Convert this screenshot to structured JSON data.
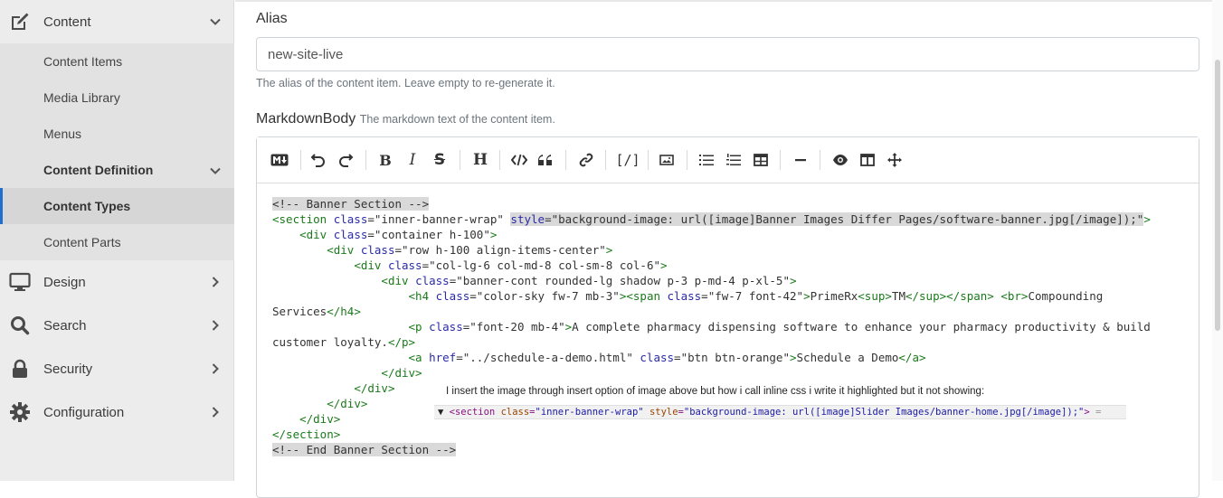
{
  "sidebar": {
    "content": {
      "label": "Content"
    },
    "content_items": {
      "label": "Content Items"
    },
    "media_library": {
      "label": "Media Library"
    },
    "menus": {
      "label": "Menus"
    },
    "content_definition": {
      "label": "Content Definition"
    },
    "content_types": {
      "label": "Content Types"
    },
    "content_parts": {
      "label": "Content Parts"
    },
    "design": {
      "label": "Design"
    },
    "search": {
      "label": "Search"
    },
    "security": {
      "label": "Security"
    },
    "configuration": {
      "label": "Configuration"
    }
  },
  "form": {
    "alias": {
      "label": "Alias",
      "value": "new-site-live",
      "help": "The alias of the content item. Leave empty to re-generate it."
    },
    "markdown": {
      "label": "MarkdownBody",
      "help": "The markdown text of the content item."
    }
  },
  "toolbar": {
    "icons": [
      "markdown-icon",
      "undo-icon",
      "redo-icon",
      "bold-icon",
      "italic-icon",
      "strikethrough-icon",
      "heading-icon",
      "code-icon",
      "quote-icon",
      "link-icon",
      "shortcode-icon",
      "image-icon",
      "unordered-list-icon",
      "ordered-list-icon",
      "table-icon",
      "horizontal-rule-icon",
      "preview-icon",
      "side-by-side-icon",
      "fullscreen-icon"
    ],
    "shortcode_glyph": "[/]"
  },
  "code": {
    "lines": [
      [
        {
          "c": "cm",
          "t": "<!-- Banner Section -->",
          "hl": true
        }
      ],
      [
        {
          "c": "tg",
          "t": "<section "
        },
        {
          "c": "at",
          "t": "class"
        },
        {
          "c": "st",
          "t": "=\"inner-banner-wrap\" "
        },
        {
          "c": "at",
          "t": "style",
          "hl": true
        },
        {
          "c": "st",
          "t": "=\"background-image: url([image]Banner Images Differ Pages/software-banner.jpg[/image]);\"",
          "hl": true
        },
        {
          "c": "tg",
          "t": ">"
        }
      ],
      [
        {
          "c": "st",
          "t": "    "
        },
        {
          "c": "tg",
          "t": "<div "
        },
        {
          "c": "at",
          "t": "class"
        },
        {
          "c": "st",
          "t": "=\"container h-100\""
        },
        {
          "c": "tg",
          "t": ">"
        }
      ],
      [
        {
          "c": "st",
          "t": "        "
        },
        {
          "c": "tg",
          "t": "<div "
        },
        {
          "c": "at",
          "t": "class"
        },
        {
          "c": "st",
          "t": "=\"row h-100 align-items-center\""
        },
        {
          "c": "tg",
          "t": ">"
        }
      ],
      [
        {
          "c": "st",
          "t": "            "
        },
        {
          "c": "tg",
          "t": "<div "
        },
        {
          "c": "at",
          "t": "class"
        },
        {
          "c": "st",
          "t": "=\"col-lg-6 col-md-8 col-sm-8 col-6\""
        },
        {
          "c": "tg",
          "t": ">"
        }
      ],
      [
        {
          "c": "st",
          "t": "                "
        },
        {
          "c": "tg",
          "t": "<div "
        },
        {
          "c": "at",
          "t": "class"
        },
        {
          "c": "st",
          "t": "=\"banner-cont rounded-lg shadow p-3 p-md-4 p-xl-5\""
        },
        {
          "c": "tg",
          "t": ">"
        }
      ],
      [
        {
          "c": "st",
          "t": "                    "
        },
        {
          "c": "tg",
          "t": "<h4 "
        },
        {
          "c": "at",
          "t": "class"
        },
        {
          "c": "st",
          "t": "=\"color-sky fw-7 mb-3\""
        },
        {
          "c": "tg",
          "t": "><span "
        },
        {
          "c": "at",
          "t": "class"
        },
        {
          "c": "st",
          "t": "=\"fw-7 font-42\""
        },
        {
          "c": "tg",
          "t": ">"
        },
        {
          "c": "st",
          "t": "PrimeRx"
        },
        {
          "c": "tg",
          "t": "<sup>"
        },
        {
          "c": "st",
          "t": "TM"
        },
        {
          "c": "tg",
          "t": "</sup></span>"
        },
        {
          "c": "st",
          "t": " "
        },
        {
          "c": "tg",
          "t": "<br>"
        },
        {
          "c": "st",
          "t": "Compounding"
        }
      ],
      [
        {
          "c": "st",
          "t": "Services"
        },
        {
          "c": "tg",
          "t": "</h4>"
        }
      ],
      [
        {
          "c": "st",
          "t": "                    "
        },
        {
          "c": "tg",
          "t": "<p "
        },
        {
          "c": "at",
          "t": "class"
        },
        {
          "c": "st",
          "t": "=\"font-20 mb-4\""
        },
        {
          "c": "tg",
          "t": ">"
        },
        {
          "c": "st",
          "t": "A complete pharmacy dispensing software to enhance your pharmacy productivity & build"
        }
      ],
      [
        {
          "c": "st",
          "t": "customer loyalty."
        },
        {
          "c": "tg",
          "t": "</p>"
        }
      ],
      [
        {
          "c": "st",
          "t": "                    "
        },
        {
          "c": "tg",
          "t": "<a "
        },
        {
          "c": "at",
          "t": "href"
        },
        {
          "c": "st",
          "t": "=\"../schedule-a-demo.html\" "
        },
        {
          "c": "at",
          "t": "class"
        },
        {
          "c": "st",
          "t": "=\"btn btn-orange\""
        },
        {
          "c": "tg",
          "t": ">"
        },
        {
          "c": "st",
          "t": "Schedule a Demo"
        },
        {
          "c": "tg",
          "t": "</a>"
        }
      ],
      [
        {
          "c": "st",
          "t": "                "
        },
        {
          "c": "tg",
          "t": "</div>"
        }
      ],
      [
        {
          "c": "st",
          "t": "            "
        },
        {
          "c": "tg",
          "t": "</div>"
        }
      ],
      [
        {
          "c": "st",
          "t": "        "
        },
        {
          "c": "tg",
          "t": "</div>"
        }
      ],
      [
        {
          "c": "st",
          "t": "    "
        },
        {
          "c": "tg",
          "t": "</div>"
        }
      ],
      [
        {
          "c": "tg",
          "t": "</section>"
        }
      ],
      [
        {
          "c": "cm",
          "t": "<!-- End Banner Section -->",
          "hl": true
        }
      ]
    ]
  },
  "note": {
    "text": "I insert the image through insert option of image above but how i call inline css i write it highlighted but it not showing:"
  },
  "devtools": {
    "arrow": "▼",
    "open": "<section",
    "attr1": "class",
    "val1": "\"inner-banner-wrap\"",
    "attr2": "style",
    "val2": "\"background-image: url([image]Slider Images/banner-home.jpg[/image]);\"",
    "close": ">",
    "suffix": " ="
  },
  "colors": {
    "accent": "#1f6fd0",
    "sidebar_bg": "#ececec",
    "submenu_bg": "#e2e2e2",
    "active_bg": "#d6d6d6"
  }
}
